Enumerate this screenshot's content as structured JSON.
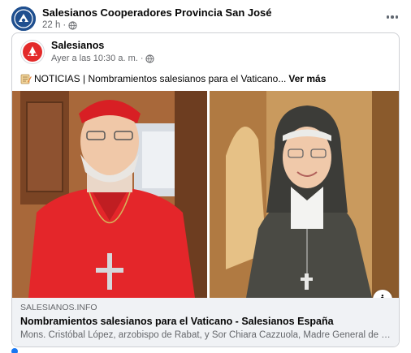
{
  "post": {
    "page_name": "Salesianos Cooperadores Provincia San José",
    "time": "22 h",
    "separator": "·",
    "privacy_icon": "globe-icon",
    "more_icon": "more-options-icon"
  },
  "shared": {
    "page_name": "Salesianos",
    "time": "Ayer a las 10:30 a. m.",
    "separator": "·",
    "privacy_icon": "globe-icon",
    "text_icon": "memo-icon",
    "text": "NOTICIAS | Nombramientos salesianos para el Vaticano...",
    "see_more": "Ver más"
  },
  "images": {
    "left_alt": "cardinal-photo",
    "right_alt": "sister-photo",
    "info_label": "i"
  },
  "link": {
    "domain": "SALESIANOS.INFO",
    "title": "Nombramientos salesianos para el Vaticano - Salesianos España",
    "description": "Mons. Cristóbal López, arzobispo de Rabat, y Sor Chiara Cazzuola, Madre General de las S..."
  },
  "colors": {
    "link_bg": "#f0f2f5",
    "meta_text": "#65676b",
    "cardinal_red": "#e4262a",
    "habit_gray": "#4a4a44"
  }
}
